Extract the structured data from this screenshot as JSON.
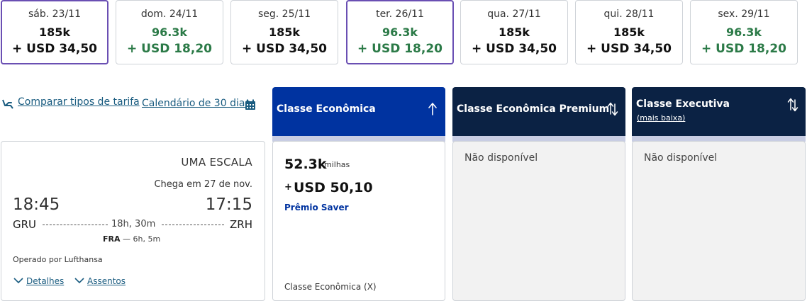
{
  "dates": [
    {
      "day": "sáb. 23/11",
      "miles": "185k",
      "price": "+ USD 34,50",
      "tone": "normal",
      "selected": true
    },
    {
      "day": "dom. 24/11",
      "miles": "96.3k",
      "price": "+ USD 18,20",
      "tone": "green",
      "selected": false
    },
    {
      "day": "seg. 25/11",
      "miles": "185k",
      "price": "+ USD 34,50",
      "tone": "normal",
      "selected": false
    },
    {
      "day": "ter. 26/11",
      "miles": "96.3k",
      "price": "+ USD 18,20",
      "tone": "green",
      "selected": true
    },
    {
      "day": "qua. 27/11",
      "miles": "185k",
      "price": "+ USD 34,50",
      "tone": "normal",
      "selected": false
    },
    {
      "day": "qui. 28/11",
      "miles": "185k",
      "price": "+ USD 34,50",
      "tone": "normal",
      "selected": false
    },
    {
      "day": "sex. 29/11",
      "miles": "96.3k",
      "price": "+ USD 18,20",
      "tone": "green",
      "selected": false
    }
  ],
  "links": {
    "compare_fares": "Comparar tipos de tarifa",
    "calendar_30": "Calendário de 30 dias"
  },
  "fare_columns": {
    "economy": {
      "title": "Classe Econômica",
      "sort_icon": "arrow-up-icon"
    },
    "premium": {
      "title": "Classe Econômica Premium",
      "sort_icon": "sort-arrows-icon"
    },
    "business": {
      "title": "Classe Executiva",
      "subtitle": "(mais baixa)",
      "sort_icon": "sort-arrows-icon"
    }
  },
  "flight": {
    "stops": "UMA ESCALA",
    "arrives": "Chega em 27 de nov.",
    "depart_time": "18:45",
    "arrive_time": "17:15",
    "origin": "GRU",
    "destination": "ZRH",
    "duration": "18h, 30m",
    "layover_airport": "FRA",
    "layover_sep": "—",
    "layover_time": "6h, 5m",
    "operated_by": "Operado por Lufthansa",
    "details_label": "Detalhes",
    "seats_label": "Assentos"
  },
  "fares": {
    "economy": {
      "miles": "52.3k",
      "miles_unit": "milhas",
      "plus": "+",
      "usd": "USD 50,10",
      "award": "Prêmio Saver",
      "cabin": "Classe Econômica (X)"
    },
    "premium": {
      "status": "Não disponível"
    },
    "business": {
      "status": "Não disponível"
    }
  },
  "colors": {
    "economy_header": "#0033a0",
    "other_header": "#0b2244",
    "selected_border": "#6a4fb3",
    "green_price": "#2b7a47",
    "link": "#1a5c80"
  }
}
